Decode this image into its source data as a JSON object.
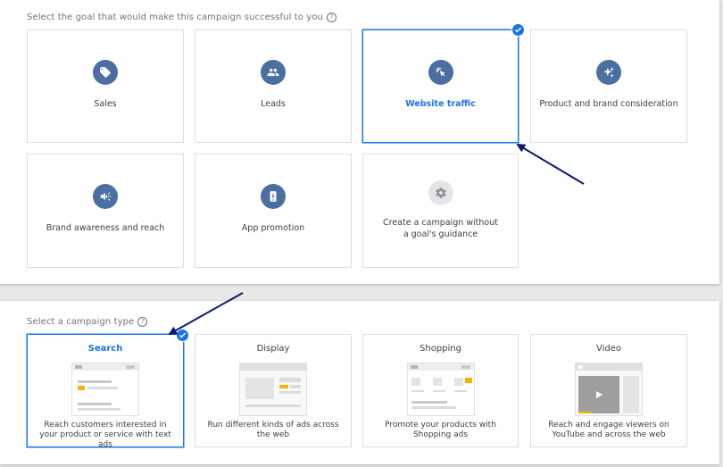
{
  "goal_section": {
    "label": "Select the goal that would make this campaign successful to you",
    "help_icon": "?",
    "goals": [
      {
        "label": "Sales",
        "icon": "tag-icon"
      },
      {
        "label": "Leads",
        "icon": "people-icon"
      },
      {
        "label": "Website traffic",
        "icon": "cursor-click-icon",
        "selected": true
      },
      {
        "label": "Product and brand consideration",
        "icon": "sparkle-icon"
      },
      {
        "label": "Brand awareness and reach",
        "icon": "megaphone-icon"
      },
      {
        "label": "App promotion",
        "icon": "phone-download-icon"
      },
      {
        "label": "Create a campaign without a goal's guidance",
        "icon": "gear-icon"
      }
    ]
  },
  "type_section": {
    "label": "Select a campaign type",
    "help_icon": "?",
    "types": [
      {
        "title": "Search",
        "description": "Reach customers interested in your product or service with text ads",
        "selected": true
      },
      {
        "title": "Display",
        "description": "Run different kinds of ads across the web"
      },
      {
        "title": "Shopping",
        "description": "Promote your products with Shopping ads"
      },
      {
        "title": "Video",
        "description": "Reach and engage viewers on YouTube and across the web"
      }
    ]
  },
  "colors": {
    "accent": "#1a73e8",
    "icon_bg": "#4a6fa1",
    "annotation_arrow": "#0d1a6e",
    "preview_yellow": "#f4b400"
  }
}
